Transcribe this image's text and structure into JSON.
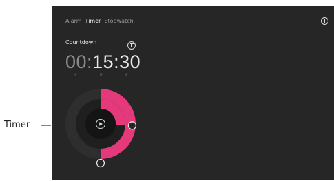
{
  "annotation": {
    "label": "Timer"
  },
  "tabs": [
    {
      "label": "Alarm",
      "active": false
    },
    {
      "label": "Timer",
      "active": true
    },
    {
      "label": "Stopwatch",
      "active": false
    }
  ],
  "timer": {
    "name": "Countdown",
    "hours": "00",
    "minutes": "15",
    "seconds": "30",
    "unit_labels": {
      "hours": "H",
      "minutes": "M",
      "seconds": "S"
    },
    "dial": {
      "minutes_fraction": 0.258,
      "seconds_fraction": 0.5
    }
  },
  "colors": {
    "accent": "#e4397a",
    "background": "#262626",
    "callout_line": "#23a8e0"
  },
  "icons": {
    "add": "plus-circle-icon",
    "delete": "trash-icon",
    "play": "play-icon"
  }
}
